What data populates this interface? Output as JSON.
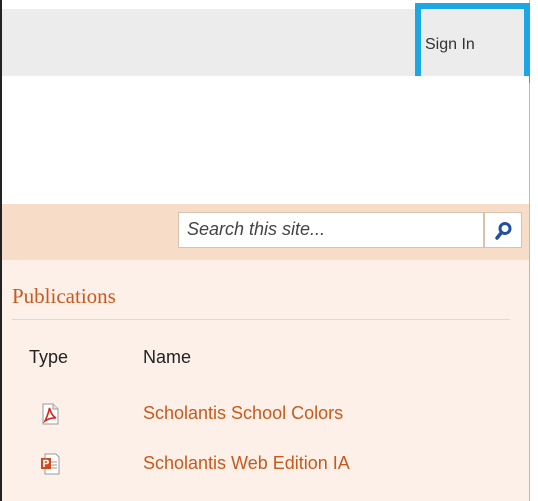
{
  "header": {
    "sign_in_label": "Sign In"
  },
  "search": {
    "placeholder": "Search this site..."
  },
  "publications": {
    "title": "Publications",
    "columns": {
      "type": "Type",
      "name": "Name"
    },
    "rows": [
      {
        "type_icon": "pdf-file-icon",
        "name": "Scholantis School Colors"
      },
      {
        "type_icon": "powerpoint-file-icon",
        "name": "Scholantis Web Edition IA"
      }
    ]
  },
  "colors": {
    "accent": "#c8591c",
    "band": "#f7ddc8",
    "panel": "#fdf0e8",
    "highlight": "#1aa7e3"
  }
}
